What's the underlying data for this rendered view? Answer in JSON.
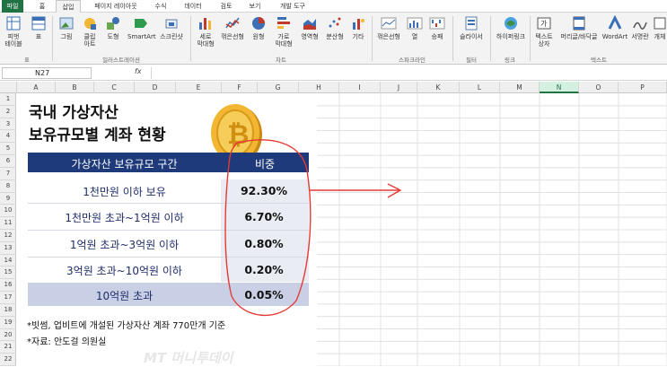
{
  "tabs": [
    "파일",
    "홈",
    "삽입",
    "페이지 레이아웃",
    "수식",
    "데이터",
    "검토",
    "보기",
    "개발 도구"
  ],
  "ribbon": {
    "buttons": [
      {
        "label": "피벗\n테이블",
        "icon": "pivot-table-icon"
      },
      {
        "label": "표",
        "icon": "table-icon"
      },
      {
        "label": "그림",
        "icon": "picture-icon"
      },
      {
        "label": "클립\n아트",
        "icon": "clipart-icon"
      },
      {
        "label": "도형",
        "icon": "shapes-icon"
      },
      {
        "label": "SmartArt",
        "icon": "smartart-icon"
      },
      {
        "label": "스크린샷",
        "icon": "screenshot-icon"
      },
      {
        "label": "세로\n막대형",
        "icon": "column-chart-icon"
      },
      {
        "label": "꺾은선형",
        "icon": "line-chart-icon"
      },
      {
        "label": "원형",
        "icon": "pie-chart-icon"
      },
      {
        "label": "가로\n막대형",
        "icon": "bar-chart-icon"
      },
      {
        "label": "영역형",
        "icon": "area-chart-icon"
      },
      {
        "label": "분산형",
        "icon": "scatter-chart-icon"
      },
      {
        "label": "기타",
        "icon": "other-chart-icon"
      },
      {
        "label": "꺾은선형",
        "icon": "sparkline-line-icon"
      },
      {
        "label": "열",
        "icon": "sparkline-column-icon"
      },
      {
        "label": "승패",
        "icon": "sparkline-winloss-icon"
      },
      {
        "label": "슬라이서",
        "icon": "slicer-icon"
      },
      {
        "label": "하이퍼링크",
        "icon": "hyperlink-icon"
      },
      {
        "label": "텍스트\n상자",
        "icon": "textbox-icon"
      },
      {
        "label": "머리글/바닥글",
        "icon": "header-footer-icon"
      },
      {
        "label": "WordArt",
        "icon": "wordart-icon"
      },
      {
        "label": "서명란",
        "icon": "signature-icon"
      },
      {
        "label": "개체",
        "icon": "object-icon"
      }
    ],
    "groups": [
      "표",
      "일러스트레이션",
      "차트",
      "스파크라인",
      "필터",
      "링크",
      "텍스트"
    ]
  },
  "formula_bar": {
    "name_box": "N27",
    "fx": "fx"
  },
  "columns": [
    "A",
    "B",
    "C",
    "D",
    "E",
    "F",
    "G",
    "H",
    "I",
    "J",
    "K",
    "L",
    "M",
    "N",
    "O",
    "P"
  ],
  "selected_column": "N",
  "rows": [
    "1",
    "2",
    "3",
    "4",
    "5",
    "6",
    "7",
    "8",
    "9",
    "10",
    "11",
    "12",
    "13",
    "14",
    "15",
    "16",
    "17",
    "18",
    "19",
    "20",
    "21",
    "22"
  ],
  "sheet": {
    "title_line1": "국내 가상자산",
    "title_line2": "보유규모별 계좌 현황",
    "header_range": "가상자산 보유규모 구간",
    "header_ratio": "비중",
    "table_rows": [
      {
        "range": "1천만원 이하 보유",
        "ratio": "92.30%"
      },
      {
        "range": "1천만원 초과~1억원 이하",
        "ratio": "6.70%"
      },
      {
        "range": "1억원 초과~3억원 이하",
        "ratio": "0.80%"
      },
      {
        "range": "3억원 초과~10억원 이하",
        "ratio": "0.20%"
      },
      {
        "range": "10억원 초과",
        "ratio": "0.05%"
      }
    ],
    "note1": "*빗썸, 업비트에 개설된 가상자산 계좌 770만개 기준",
    "note2": "*자료: 안도걸 의원실",
    "watermark": "MT 머니투데이"
  },
  "colors": {
    "header_bg": "#1f3a7a",
    "row_alt": "#dde3ef",
    "last_row": "#c9d0e6",
    "excel_green": "#217346",
    "annotation": "#e53935"
  }
}
